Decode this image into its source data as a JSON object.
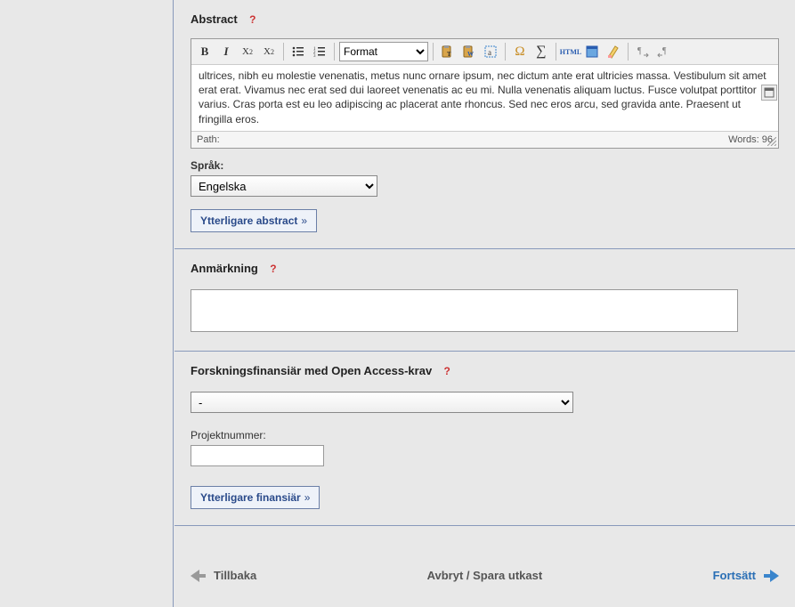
{
  "abstract": {
    "title": "Abstract",
    "help": "?",
    "format_label": "Format",
    "text": "ultrices, nibh eu molestie venenatis, metus nunc ornare ipsum, nec dictum ante erat ultricies massa. Vestibulum sit amet erat erat. Vivamus nec erat sed dui laoreet venenatis ac eu mi. Nulla venenatis aliquam luctus. Fusce volutpat porttitor varius. Cras porta est eu leo adipiscing ac placerat ante rhoncus. Sed nec eros arcu, sed gravida ante. Praesent ut fringilla eros.",
    "path_label": "Path:",
    "word_count": "Words: 96",
    "language_label": "Språk:",
    "language_value": "Engelska",
    "add_button": "Ytterligare abstract"
  },
  "note": {
    "title": "Anmärkning",
    "help": "?",
    "value": ""
  },
  "funder": {
    "title": "Forskningsfinansiär med Open Access-krav",
    "help": "?",
    "selected": "-",
    "project_label": "Projektnummer:",
    "project_value": "",
    "add_button": "Ytterligare finansiär"
  },
  "footer": {
    "back": "Tillbaka",
    "cancel": "Avbryt / Spara utkast",
    "continue": "Fortsätt"
  }
}
